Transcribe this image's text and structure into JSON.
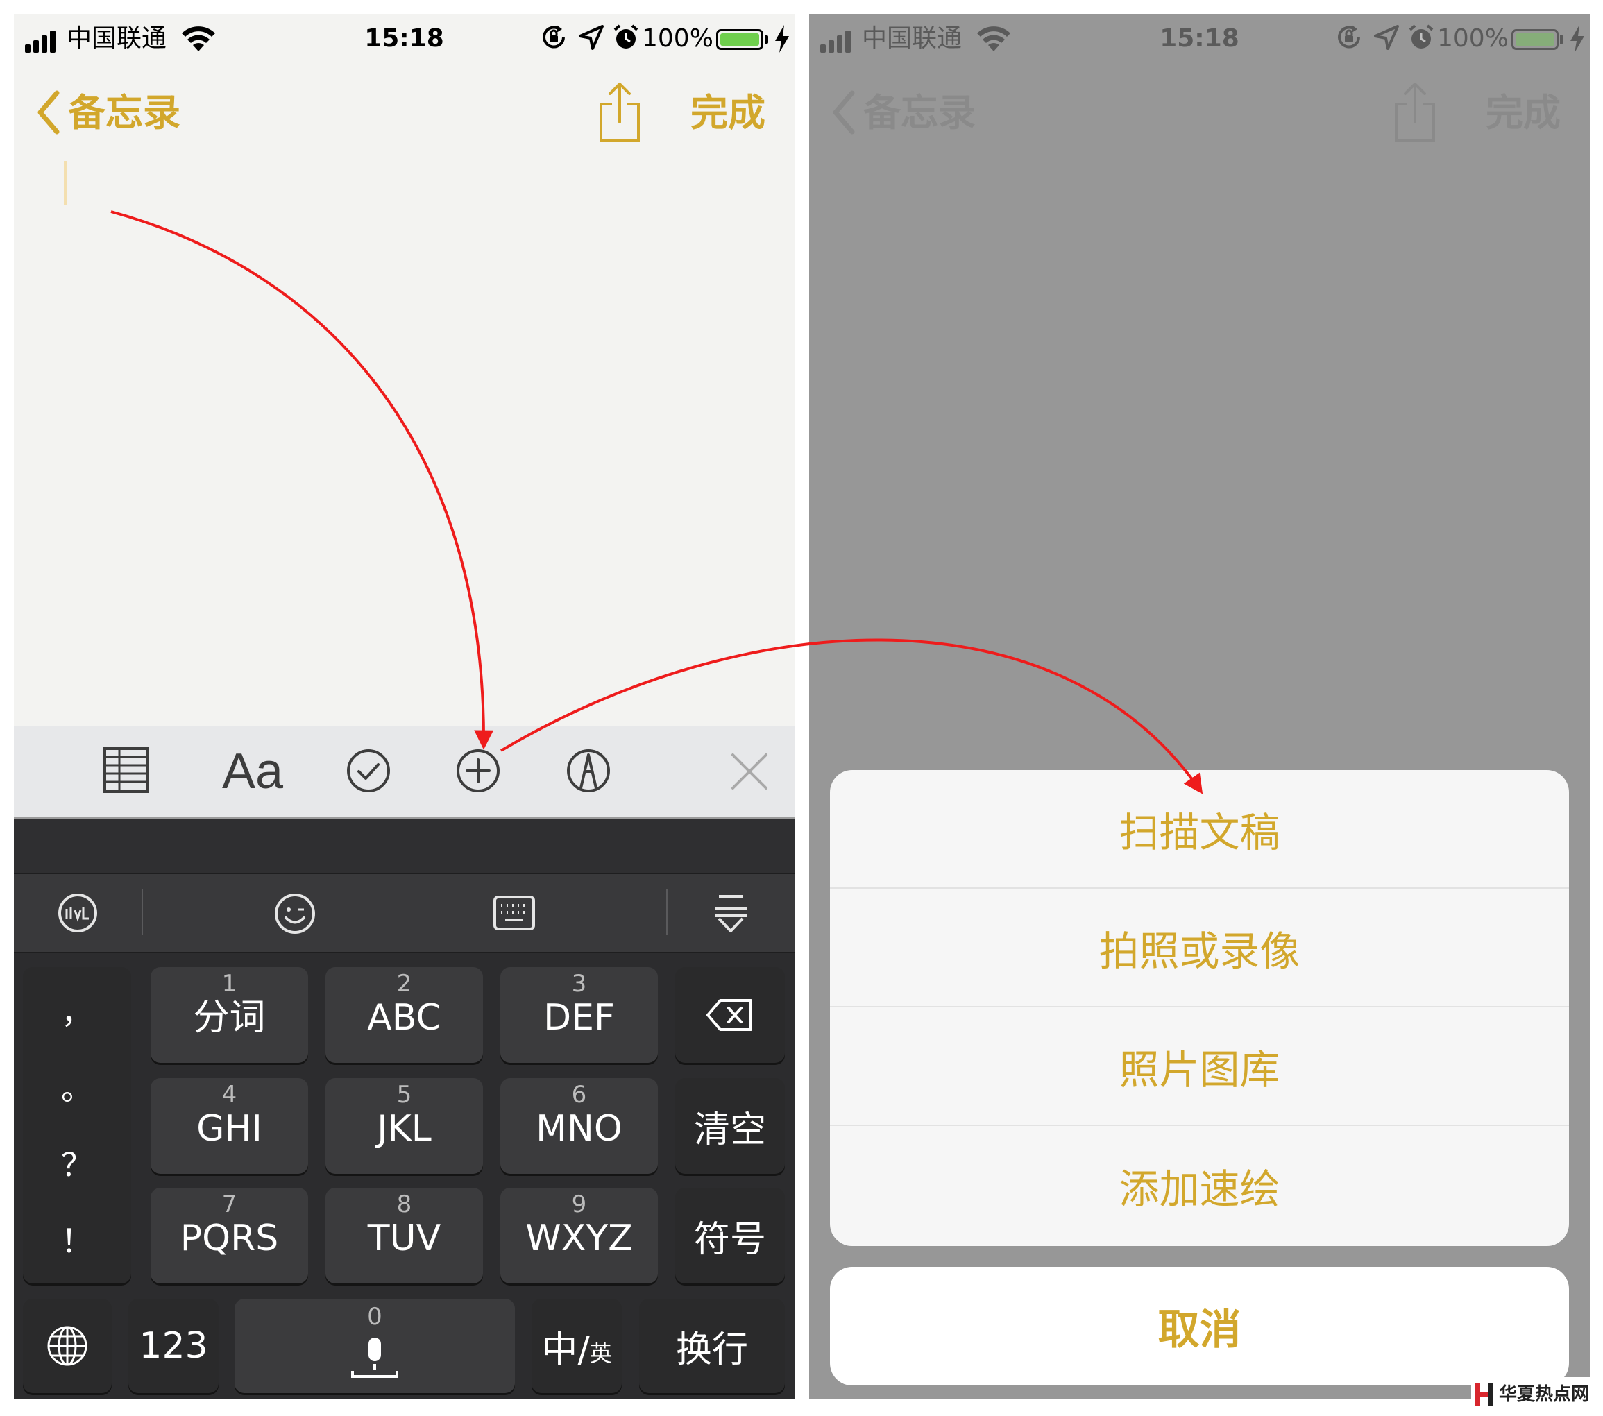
{
  "status_bar": {
    "carrier": "中国联通",
    "time": "15:18",
    "battery_percent": "100%",
    "battery_level": 1.0,
    "battery_color": "#6fcf4d",
    "icons": [
      "signal-icon",
      "wifi-icon",
      "orientation-lock-icon",
      "location-icon",
      "alarm-icon",
      "battery-icon",
      "charging-icon"
    ]
  },
  "nav": {
    "back_label": "备忘录",
    "done_label": "完成",
    "accent_color": "#d2a72c"
  },
  "toolbar": {
    "format_label": "Aa",
    "icons": [
      "table-icon",
      "format-icon",
      "checklist-icon",
      "add-icon",
      "markup-icon",
      "close-icon"
    ]
  },
  "keyboard": {
    "tool_icons": [
      "ifly-logo-icon",
      "emoji-icon",
      "keyboard-icon",
      "collapse-keyboard-icon"
    ],
    "punctuation": [
      "，",
      "。",
      "？",
      "！"
    ],
    "keys": [
      {
        "num": "1",
        "label": "分词"
      },
      {
        "num": "2",
        "label": "ABC"
      },
      {
        "num": "3",
        "label": "DEF"
      },
      {
        "num": "4",
        "label": "GHI"
      },
      {
        "num": "5",
        "label": "JKL"
      },
      {
        "num": "6",
        "label": "MNO"
      },
      {
        "num": "7",
        "label": "PQRS"
      },
      {
        "num": "8",
        "label": "TUV"
      },
      {
        "num": "9",
        "label": "WXYZ"
      }
    ],
    "clear_label": "清空",
    "symbols_label": "符号",
    "numbers_label": "123",
    "space_num": "0",
    "lang_main": "中/",
    "lang_sub": "英",
    "return_label": "换行"
  },
  "action_sheet": {
    "items": [
      "扫描文稿",
      "拍照或录像",
      "照片图库",
      "添加速绘"
    ],
    "cancel_label": "取消"
  },
  "watermark": {
    "text": "华夏热点网"
  }
}
